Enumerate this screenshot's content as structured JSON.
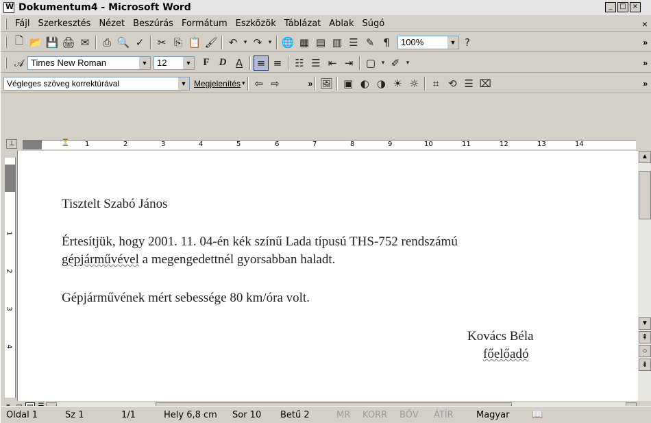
{
  "window": {
    "title": "Dokumentum4 - Microsoft Word",
    "controls": {
      "minimize": "_",
      "maximize": "□",
      "close": "×"
    }
  },
  "menubar": {
    "items": [
      "Fájl",
      "Szerkesztés",
      "Nézet",
      "Beszúrás",
      "Formátum",
      "Eszközök",
      "Táblázat",
      "Ablak",
      "Súgó"
    ],
    "close": "×"
  },
  "toolbar_standard": {
    "zoom": "100%",
    "pilcrow": "¶",
    "help": "?"
  },
  "toolbar_formatting": {
    "font": "Times New Roman",
    "size": "12",
    "bold": "F",
    "italic": "D",
    "underline": "A"
  },
  "toolbar_reviewing": {
    "display_mode": "Végleges szöveg korrektúrával",
    "show_label": "Megjelenítés"
  },
  "ruler": {
    "corner": "⊥",
    "labels": [
      "1",
      "2",
      "3",
      "4",
      "5",
      "6",
      "7",
      "8",
      "9",
      "10",
      "11",
      "12",
      "13",
      "14"
    ],
    "vlabels": [
      "1",
      "2",
      "3",
      "4"
    ]
  },
  "document": {
    "salutation": "Tisztelt Szabó János",
    "line1": "Értesítjük, hogy 2001. 11. 04-én kék színű Lada típusú THS-752 rendszámú",
    "line2_word": "gépjárművével",
    "line2_rest": " a megengedettnél gyorsabban haladt.",
    "line3": "Gépjárművének mért sebessége 80 km/óra volt.",
    "signature_name": "Kovács Béla",
    "signature_title": "főelőadó"
  },
  "statusbar": {
    "page": "Oldal 1",
    "section": "Sz 1",
    "pages": "1/1",
    "position": "Hely 6,8 cm",
    "line": "Sor 10",
    "column": "Betű 2",
    "mr": "MR",
    "korr": "KORR",
    "bov": "BŐV",
    "atir": "ÁTÍR",
    "language": "Magyar"
  }
}
